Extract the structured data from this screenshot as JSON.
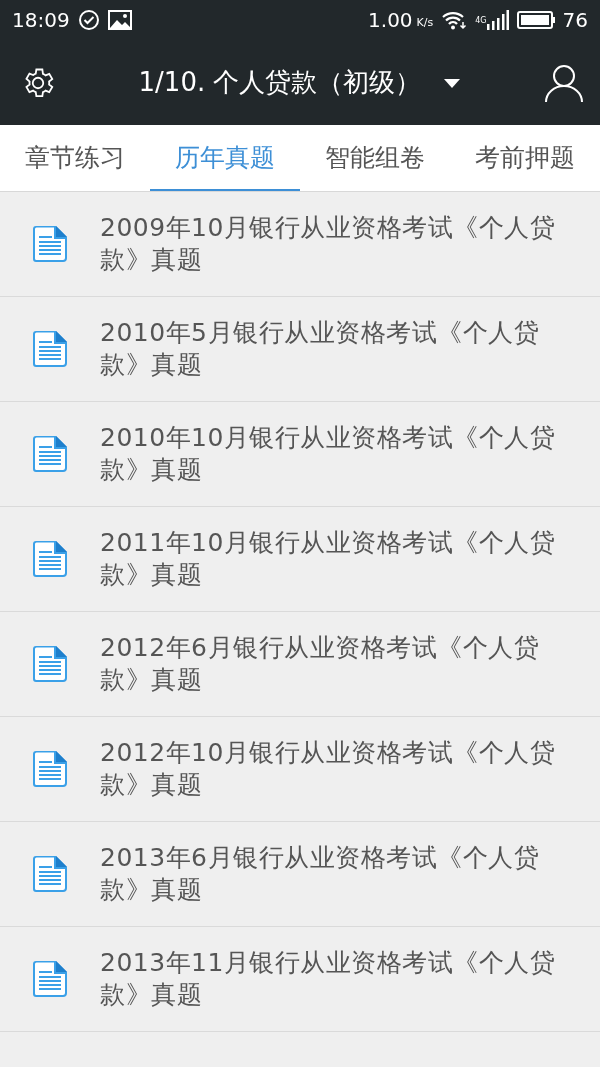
{
  "status_bar": {
    "time": "18:09",
    "speed": "1.00",
    "speed_unit": "K/s",
    "network": "4G",
    "battery": "76"
  },
  "header": {
    "title": "1/10. 个人贷款（初级）"
  },
  "tabs": [
    {
      "label": "章节练习",
      "selected": false
    },
    {
      "label": "历年真题",
      "selected": true
    },
    {
      "label": "智能组卷",
      "selected": false
    },
    {
      "label": "考前押题",
      "selected": false
    }
  ],
  "papers": [
    {
      "title": "2009年10月银行从业资格考试《个人贷款》真题"
    },
    {
      "title": "2010年5月银行从业资格考试《个人贷款》真题"
    },
    {
      "title": "2010年10月银行从业资格考试《个人贷款》真题"
    },
    {
      "title": "2011年10月银行从业资格考试《个人贷款》真题"
    },
    {
      "title": "2012年6月银行从业资格考试《个人贷款》真题"
    },
    {
      "title": "2012年10月银行从业资格考试《个人贷款》真题"
    },
    {
      "title": "2013年6月银行从业资格考试《个人贷款》真题"
    },
    {
      "title": "2013年11月银行从业资格考试《个人贷款》真题"
    }
  ]
}
